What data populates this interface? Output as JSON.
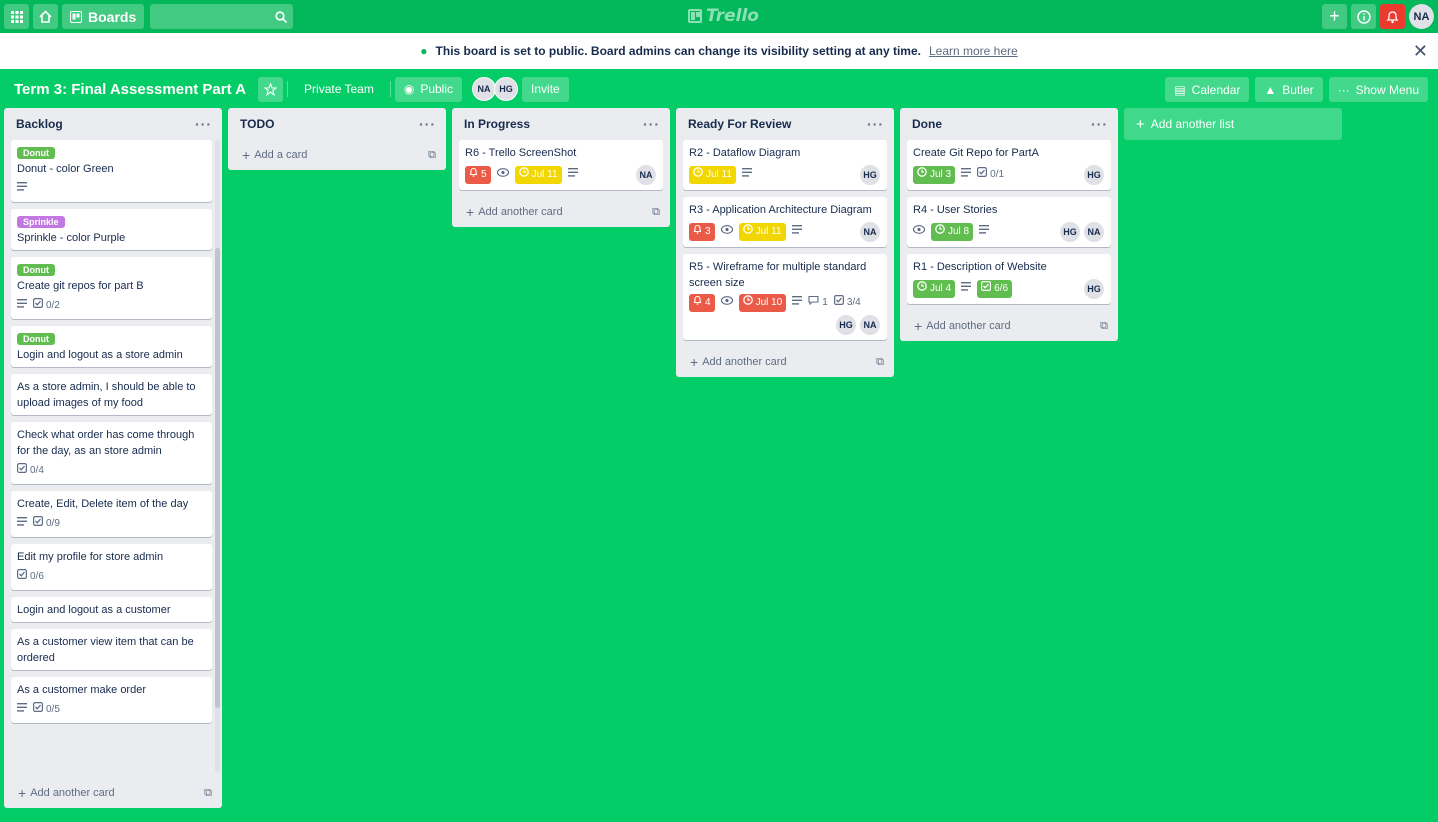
{
  "topbar": {
    "boards_label": "Boards",
    "logo_text": "Trello",
    "user_initials": "NA"
  },
  "banner": {
    "message": "This board is set to public. Board admins can change its visibility setting at any time.",
    "link": "Learn more here"
  },
  "board": {
    "title": "Term 3: Final Assessment Part A",
    "team": "Private Team",
    "visibility": "Public",
    "members": [
      "NA",
      "HG"
    ],
    "invite": "Invite",
    "calendar": "Calendar",
    "butler": "Butler",
    "show_menu": "Show Menu",
    "add_list": "Add another list"
  },
  "colors": {
    "background": "#04cc67",
    "label_green": "#61bd4f",
    "label_purple": "#c377e0",
    "due_yellow": "#f2d600",
    "due_red": "#eb5a46"
  },
  "lists": [
    {
      "title": "Backlog",
      "footer": "Add another card",
      "cards": [
        {
          "label": "Donut",
          "title": "Donut - color Green",
          "desc": true
        },
        {
          "label": "Sprinkle",
          "title": "Sprinkle - color Purple"
        },
        {
          "label": "Donut",
          "title": "Create git repos for part B",
          "desc": true,
          "checklist": "0/2"
        },
        {
          "label": "Donut",
          "title": "Login and logout as a store admin"
        },
        {
          "title": "As a store admin, I should be able to upload images of my food"
        },
        {
          "title": "Check what order has come through for the day, as an store admin",
          "checklist": "0/4"
        },
        {
          "title": "Create, Edit, Delete item of the day",
          "desc": true,
          "checklist": "0/9"
        },
        {
          "title": "Edit my profile for store admin",
          "checklist": "0/6"
        },
        {
          "title": "Login and logout as a customer"
        },
        {
          "title": "As a customer view item that can be ordered"
        },
        {
          "title": "As a customer make order",
          "desc": true,
          "checklist": "0/5"
        }
      ]
    },
    {
      "title": "TODO",
      "footer": "Add a card",
      "cards": []
    },
    {
      "title": "In Progress",
      "footer": "Add another card",
      "cards": [
        {
          "title": "R6 - Trello ScreenShot",
          "notifications": "5",
          "watch": true,
          "due": "Jul 11",
          "due_color": "yellow",
          "desc": true,
          "members": [
            "NA"
          ]
        }
      ]
    },
    {
      "title": "Ready For Review",
      "footer": "Add another card",
      "cards": [
        {
          "title": "R2 - Dataflow Diagram",
          "due": "Jul 11",
          "due_color": "yellow",
          "desc": true,
          "members": [
            "HG"
          ]
        },
        {
          "title": "R3 - Application Architecture Diagram",
          "notifications": "3",
          "watch": true,
          "due": "Jul 11",
          "due_color": "yellow",
          "desc": true,
          "members": [
            "NA"
          ]
        },
        {
          "title": "R5 - Wireframe for multiple standard screen size",
          "notifications": "4",
          "watch": true,
          "due": "Jul 10",
          "due_color": "red",
          "desc": true,
          "comments": "1",
          "checklist": "3/4",
          "members": [
            "HG",
            "NA"
          ]
        }
      ]
    },
    {
      "title": "Done",
      "footer": "Add another card",
      "cards": [
        {
          "title": "Create Git Repo for PartA",
          "due": "Jul 3",
          "due_color": "green",
          "desc": true,
          "checklist": "0/1",
          "members": [
            "HG"
          ]
        },
        {
          "title": "R4 - User Stories",
          "watch": true,
          "due": "Jul 8",
          "due_color": "green",
          "desc": true,
          "members": [
            "HG",
            "NA"
          ]
        },
        {
          "title": "R1 - Description of Website",
          "due": "Jul 4",
          "due_color": "green",
          "desc": true,
          "checklist": "6/6",
          "checklist_done": true,
          "members": [
            "HG"
          ]
        }
      ]
    }
  ]
}
